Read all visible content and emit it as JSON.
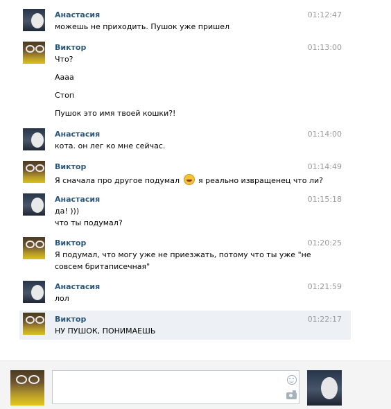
{
  "messages": [
    {
      "author": "Анастасия",
      "time": "01:12:47",
      "lines": [
        "можешь не приходить. Пушок уже пришел"
      ]
    },
    {
      "author": "Виктор",
      "time": "01:13:00",
      "lines": [
        "Что?",
        "Аааа",
        "Стоп",
        "Пушок это имя твоей кошки?!"
      ]
    },
    {
      "author": "Анастасия",
      "time": "01:14:00",
      "lines": [
        "кота. он лег ко мне сейчас."
      ]
    },
    {
      "author": "Виктор",
      "time": "01:14:49",
      "lines": [
        "Я сначала про другое подумал",
        "я реально извращенец что ли?"
      ]
    },
    {
      "author": "Анастасия",
      "time": "01:15:18",
      "lines": [
        "да! )))",
        "что ты подумал?"
      ]
    },
    {
      "author": "Виктор",
      "time": "01:20:25",
      "lines": [
        "Я подумал, что могу уже не приезжать, потому что ты уже \"не",
        "совсем бритаписечная\""
      ]
    },
    {
      "author": "Анастасия",
      "time": "01:21:59",
      "lines": [
        "лол"
      ]
    },
    {
      "author": "Виктор",
      "time": "01:22:17",
      "lines": [
        "НУ ПУШОК, ПОНИМАЕШЬ"
      ]
    }
  ],
  "composer": {
    "placeholder": "",
    "icons": [
      "smile-icon",
      "camera-icon"
    ]
  },
  "colors": {
    "author": "#2b587a",
    "time": "#999999",
    "highlight": "#edf1f5",
    "composer_bg": "#f4f4f4"
  }
}
